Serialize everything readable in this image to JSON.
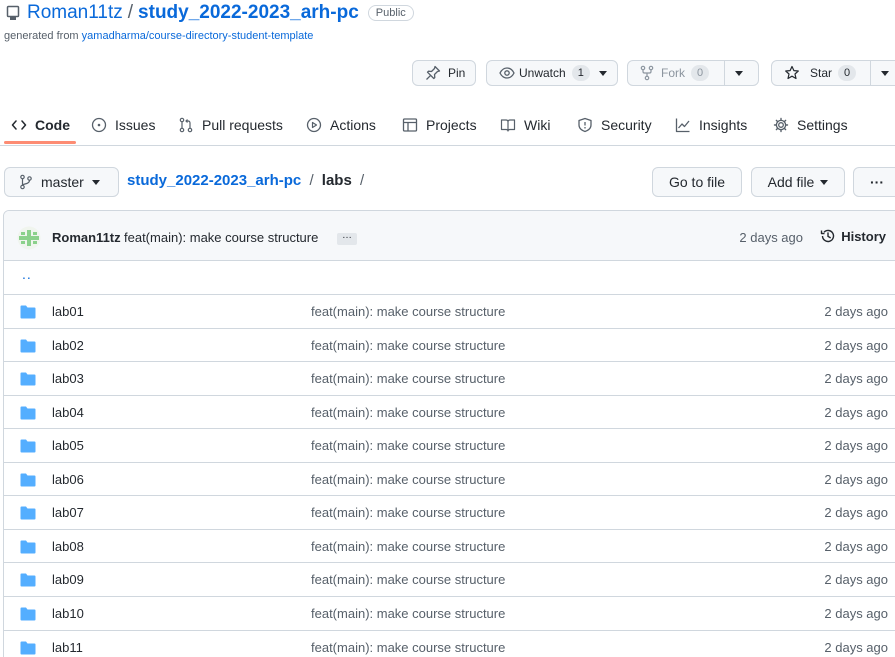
{
  "repo": {
    "owner": "Roman11tz",
    "separator": "/",
    "name": "study_2022-2023_arh-pc",
    "visibility": "Public",
    "generated_from_prefix": "generated from",
    "generated_from_link": "yamadharma/course-directory-student-template"
  },
  "actions": {
    "pin": "Pin",
    "unwatch": "Unwatch",
    "watch_count": "1",
    "fork": "Fork",
    "fork_count": "0",
    "star": "Star",
    "star_count": "0"
  },
  "tabs": [
    {
      "label": "Code",
      "icon": "code-icon",
      "active": true
    },
    {
      "label": "Issues",
      "icon": "issue-icon"
    },
    {
      "label": "Pull requests",
      "icon": "pull-request-icon"
    },
    {
      "label": "Actions",
      "icon": "play-icon"
    },
    {
      "label": "Projects",
      "icon": "table-icon"
    },
    {
      "label": "Wiki",
      "icon": "book-icon"
    },
    {
      "label": "Security",
      "icon": "shield-icon"
    },
    {
      "label": "Insights",
      "icon": "graph-icon"
    },
    {
      "label": "Settings",
      "icon": "gear-icon"
    }
  ],
  "branch": {
    "name": "master"
  },
  "breadcrumb": {
    "root": "study_2022-2023_arh-pc",
    "separator": "/",
    "current": "labs",
    "trailing": "/"
  },
  "buttons": {
    "go_to_file": "Go to file",
    "add_file": "Add file",
    "more": "···"
  },
  "latest_commit": {
    "author": "Roman11tz",
    "message": "feat(main): make course structure",
    "ellipsis": "…",
    "time": "2 days ago",
    "history_label": "History"
  },
  "parent_dir": "..",
  "files": [
    {
      "name": "lab01",
      "message": "feat(main): make course structure",
      "time": "2 days ago"
    },
    {
      "name": "lab02",
      "message": "feat(main): make course structure",
      "time": "2 days ago"
    },
    {
      "name": "lab03",
      "message": "feat(main): make course structure",
      "time": "2 days ago"
    },
    {
      "name": "lab04",
      "message": "feat(main): make course structure",
      "time": "2 days ago"
    },
    {
      "name": "lab05",
      "message": "feat(main): make course structure",
      "time": "2 days ago"
    },
    {
      "name": "lab06",
      "message": "feat(main): make course structure",
      "time": "2 days ago"
    },
    {
      "name": "lab07",
      "message": "feat(main): make course structure",
      "time": "2 days ago"
    },
    {
      "name": "lab08",
      "message": "feat(main): make course structure",
      "time": "2 days ago"
    },
    {
      "name": "lab09",
      "message": "feat(main): make course structure",
      "time": "2 days ago"
    },
    {
      "name": "lab10",
      "message": "feat(main): make course structure",
      "time": "2 days ago"
    },
    {
      "name": "lab11",
      "message": "feat(main): make course structure",
      "time": "2 days ago"
    }
  ],
  "colors": {
    "link": "#0969da",
    "folder": "#54aeff",
    "tab_underline": "#fd8c73"
  }
}
